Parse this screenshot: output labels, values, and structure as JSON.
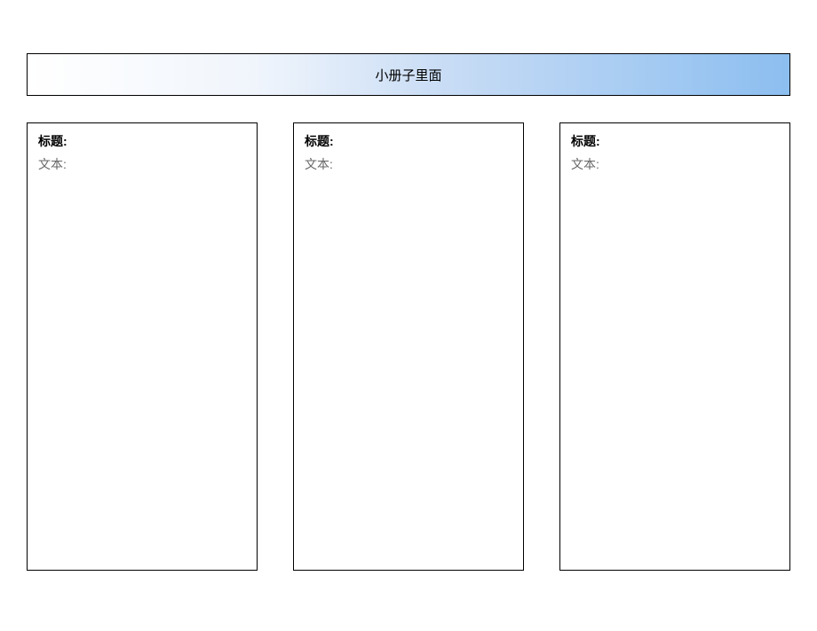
{
  "banner": {
    "title": "小册子里面"
  },
  "panels": [
    {
      "title_label": "标题:",
      "text_label": "文本:"
    },
    {
      "title_label": "标题:",
      "text_label": "文本:"
    },
    {
      "title_label": "标题:",
      "text_label": "文本:"
    }
  ]
}
